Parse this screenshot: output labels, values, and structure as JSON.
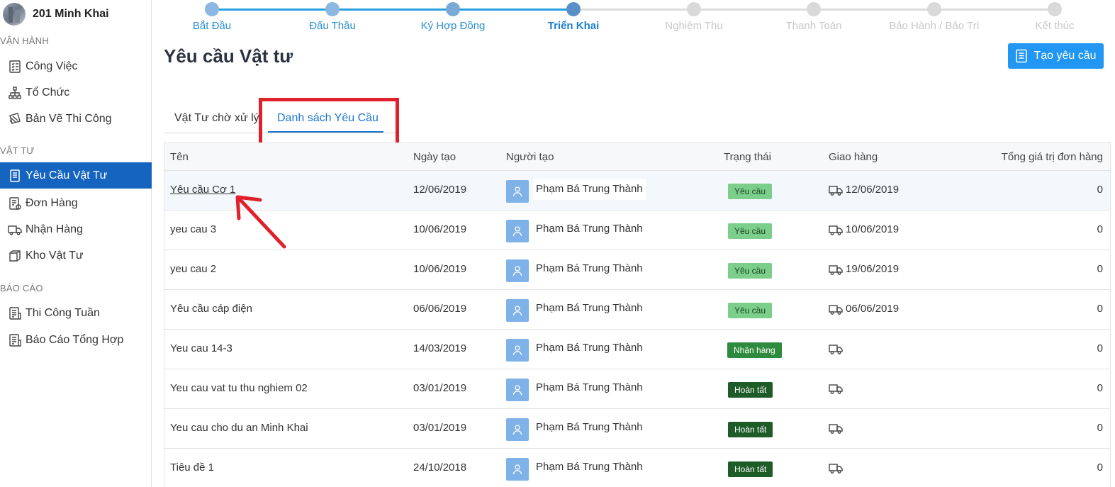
{
  "project": {
    "name": "201 Minh Khai"
  },
  "sidebar": {
    "sections": [
      {
        "title": "VẬN HÀNH",
        "items": [
          "Công Việc",
          "Tổ Chức",
          "Bản Vẽ Thi Công"
        ]
      },
      {
        "title": "VẬT TƯ",
        "items": [
          "Yêu Cầu Vật Tư",
          "Đơn Hàng",
          "Nhận Hàng",
          "Kho Vật Tư"
        ]
      },
      {
        "title": "BÁO CÁO",
        "items": [
          "Thi Công Tuần",
          "Báo Cáo Tổng Hợp"
        ]
      }
    ],
    "active_item": "Yêu Cầu Vật Tư"
  },
  "steps": [
    {
      "label": "Bắt Đầu",
      "state": "done"
    },
    {
      "label": "Đấu Thầu",
      "state": "done"
    },
    {
      "label": "Ký Hợp Đồng",
      "state": "done"
    },
    {
      "label": "Triển Khai",
      "state": "current"
    },
    {
      "label": "Nghiệm Thu",
      "state": "todo"
    },
    {
      "label": "Thanh Toán",
      "state": "todo"
    },
    {
      "label": "Bảo Hành / Bảo Trì",
      "state": "todo"
    },
    {
      "label": "Kết thúc",
      "state": "todo"
    }
  ],
  "page": {
    "title": "Yêu cầu Vật tư",
    "create_button": "Tạo yêu cầu"
  },
  "tabs": [
    {
      "label": "Vật Tư chờ xử lý",
      "active": false
    },
    {
      "label": "Danh sách Yêu Cầu",
      "active": true
    }
  ],
  "table": {
    "headers": {
      "name": "Tên",
      "created": "Ngày tạo",
      "creator": "Người tạo",
      "status": "Trạng thái",
      "delivery": "Giao hàng",
      "total": "Tổng giá trị đơn hàng"
    },
    "rows": [
      {
        "name": "Yêu cầu Cơ 1",
        "created": "12/06/2019",
        "creator": "Phạm Bá Trung Thành",
        "status": "Yêu cầu",
        "delivery": "12/06/2019",
        "total": "0"
      },
      {
        "name": "yeu cau 3",
        "created": "10/06/2019",
        "creator": "Phạm Bá Trung Thành",
        "status": "Yêu cầu",
        "delivery": "10/06/2019",
        "total": "0"
      },
      {
        "name": "yeu cau 2",
        "created": "10/06/2019",
        "creator": "Phạm Bá Trung Thành",
        "status": "Yêu cầu",
        "delivery": "19/06/2019",
        "total": "0"
      },
      {
        "name": "Yêu cầu cáp điện",
        "created": "06/06/2019",
        "creator": "Phạm Bá Trung Thành",
        "status": "Yêu cầu",
        "delivery": "06/06/2019",
        "total": "0"
      },
      {
        "name": "Yeu cau 14-3",
        "created": "14/03/2019",
        "creator": "Phạm Bá Trung Thành",
        "status": "Nhận hàng",
        "delivery": "",
        "total": "0"
      },
      {
        "name": "Yeu cau vat tu thu nghiem 02",
        "created": "03/01/2019",
        "creator": "Phạm Bá Trung Thành",
        "status": "Hoàn tất",
        "delivery": "",
        "total": "0"
      },
      {
        "name": "Yeu cau cho du an Minh Khai",
        "created": "03/01/2019",
        "creator": "Phạm Bá Trung Thành",
        "status": "Hoàn tất",
        "delivery": "",
        "total": "0"
      },
      {
        "name": "Tiêu đề 1",
        "created": "24/10/2018",
        "creator": "Phạm Bá Trung Thành",
        "status": "Hoàn tất",
        "delivery": "",
        "total": "0"
      }
    ]
  },
  "colors": {
    "primary": "#1565c0",
    "button": "#2196f3",
    "step_done": "#8ab8e0",
    "step_current": "#5a8fc7",
    "step_todo": "#d9d9d9",
    "annotation": "#e0202a",
    "badge_request": "#7ccf8a",
    "badge_received": "#2e8b3e",
    "badge_done": "#1d5c27"
  },
  "icons": {
    "nav": [
      "checklist-icon",
      "org-chart-icon",
      "drawing-icon",
      "document-icon",
      "order-icon",
      "truck-icon",
      "box-icon",
      "report-icon",
      "report-icon"
    ],
    "create": "document-icon",
    "avatar": "user-icon",
    "delivery": "truck-icon"
  }
}
